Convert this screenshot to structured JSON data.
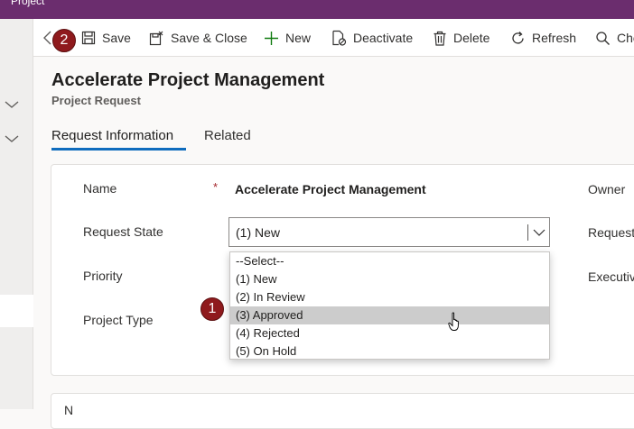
{
  "app": {
    "title": "Project"
  },
  "toolbar": {
    "save_label": "Save",
    "save_close_label": "Save & Close",
    "new_label": "New",
    "deactivate_label": "Deactivate",
    "delete_label": "Delete",
    "refresh_label": "Refresh",
    "check_label": "Che"
  },
  "badges": {
    "step1": "1",
    "step2": "2"
  },
  "header": {
    "title": "Accelerate Project Management",
    "subtitle": "Project Request"
  },
  "tabs": [
    {
      "label": "Request Information",
      "active": true
    },
    {
      "label": "Related",
      "active": false
    }
  ],
  "form": {
    "name_label": "Name",
    "required_mark": "*",
    "name_value": "Accelerate Project Management",
    "request_state_label": "Request State",
    "request_state_value": "(1) New",
    "priority_label": "Priority",
    "project_type_label": "Project Type",
    "owner_label": "Owner",
    "requester_label": "Requeste",
    "executive_label": "Executiv"
  },
  "dropdown": {
    "options": [
      "--Select--",
      "(1) New",
      "(2) In Review",
      "(3) Approved",
      "(4) Rejected",
      "(5) On Hold"
    ],
    "highlighted": "(3) Approved"
  },
  "second_section": {
    "peek_text": "N"
  },
  "colors": {
    "topbar": "#6b2d6e",
    "badge": "#8f1a1d",
    "tab_underline": "#0f6cbd",
    "required": "#a4262c",
    "highlight": "#cccccc"
  }
}
